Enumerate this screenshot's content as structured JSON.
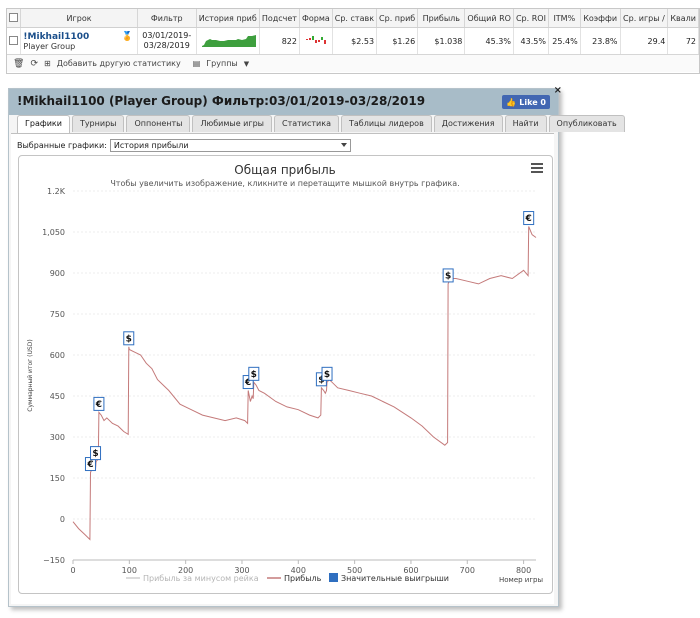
{
  "stats": {
    "headers": [
      "Игрок",
      "Фильтр",
      "История приб",
      "Подсчет",
      "Форма",
      "Ср. ставк",
      "Ср. приб",
      "Прибыль",
      "Общий RO",
      "Ср. ROI",
      "ITM%",
      "Коэффи",
      "Ср. игры /",
      "Квали"
    ],
    "player_name": "!Mikhail1100",
    "player_group": "Player Group",
    "filter_line1": "03/01/2019-",
    "filter_line2": "03/28/2019",
    "count": "822",
    "avg_stake": "$2.53",
    "avg_profit": "$1.26",
    "profit": "$1.038",
    "total_roi": "45.3%",
    "avg_roi": "43.5%",
    "itm": "25.4%",
    "coef": "23.8%",
    "avg_games": "29.4",
    "quali": "72",
    "add_stat_label": "Добавить другую статистику",
    "groups_label": "Группы"
  },
  "panel": {
    "title": "!Mikhail1100 (Player Group) Фильтр:03/01/2019-03/28/2019",
    "like_label": "Like 0",
    "close_label": "×",
    "tabs": [
      "Графики",
      "Турниры",
      "Оппоненты",
      "Любимые игры",
      "Статистика",
      "Таблицы лидеров",
      "Достижения",
      "Найти",
      "Опубликовать"
    ],
    "select_label": "Выбранные графики:",
    "select_value": "История прибыли"
  },
  "chart_data": {
    "type": "line",
    "title": "Общая прибыль",
    "subtitle": "Чтобы увеличить изображение, кликните и перетащите мышкой внутрь графика.",
    "xlabel": "Номер игры",
    "ylabel": "Суммарный итог (USD)",
    "xlim": [
      0,
      822
    ],
    "ylim": [
      -150,
      1200
    ],
    "x_ticks": [
      0,
      100,
      200,
      300,
      400,
      500,
      600,
      700,
      800
    ],
    "y_ticks": [
      -150,
      0,
      150,
      300,
      450,
      600,
      750,
      900,
      1050,
      1200
    ],
    "y_tick_labels": [
      "−150",
      "0",
      "150",
      "300",
      "450",
      "600",
      "750",
      "900",
      "1,050",
      "1.2K"
    ],
    "grid": true,
    "legend": [
      "Прибыль за минусом рейка",
      "Прибыль",
      "Значительные выигрыши"
    ],
    "legend_placement": "bottom",
    "series": [
      {
        "name": "Прибыль",
        "color": "#c47a7a",
        "x": [
          0,
          10,
          20,
          30,
          31,
          35,
          40,
          41,
          45,
          46,
          50,
          55,
          60,
          70,
          80,
          90,
          98,
          99,
          100,
          110,
          120,
          130,
          140,
          150,
          170,
          190,
          210,
          230,
          250,
          270,
          290,
          305,
          310,
          311,
          315,
          318,
          320,
          321,
          325,
          330,
          340,
          360,
          380,
          400,
          420,
          435,
          440,
          441,
          445,
          448,
          450,
          451,
          455,
          460,
          470,
          490,
          510,
          530,
          550,
          570,
          600,
          620,
          640,
          660,
          665,
          666,
          670,
          680,
          700,
          720,
          740,
          760,
          780,
          800,
          808,
          809,
          815,
          822
        ],
        "y": [
          -10,
          -35,
          -55,
          -75,
          170,
          190,
          180,
          210,
          220,
          390,
          380,
          360,
          370,
          350,
          340,
          320,
          310,
          630,
          620,
          610,
          600,
          570,
          550,
          510,
          470,
          420,
          400,
          380,
          370,
          360,
          370,
          360,
          350,
          470,
          430,
          450,
          440,
          500,
          490,
          470,
          460,
          430,
          410,
          400,
          380,
          370,
          380,
          480,
          470,
          460,
          470,
          500,
          510,
          500,
          480,
          470,
          460,
          450,
          430,
          410,
          370,
          340,
          300,
          270,
          280,
          860,
          880,
          880,
          870,
          860,
          880,
          890,
          880,
          910,
          890,
          1070,
          1040,
          1030
        ]
      }
    ],
    "markers": [
      {
        "x": 31,
        "y": 170,
        "symbol": "€"
      },
      {
        "x": 40,
        "y": 210,
        "symbol": "$"
      },
      {
        "x": 46,
        "y": 390,
        "symbol": "€"
      },
      {
        "x": 99,
        "y": 630,
        "symbol": "$"
      },
      {
        "x": 311,
        "y": 470,
        "symbol": "€"
      },
      {
        "x": 321,
        "y": 500,
        "symbol": "$"
      },
      {
        "x": 441,
        "y": 480,
        "symbol": "$"
      },
      {
        "x": 451,
        "y": 500,
        "symbol": "$"
      },
      {
        "x": 666,
        "y": 860,
        "symbol": "$"
      },
      {
        "x": 809,
        "y": 1070,
        "symbol": "€"
      }
    ]
  }
}
